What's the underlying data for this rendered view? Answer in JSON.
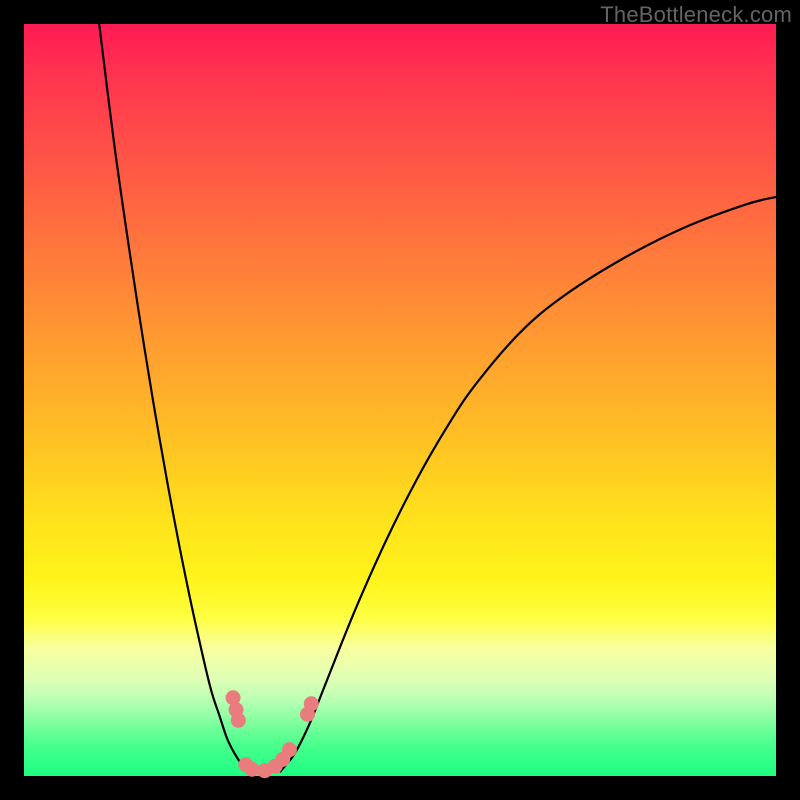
{
  "watermark": "TheBottleneck.com",
  "colors": {
    "frame": "#000000",
    "gradient_top": "#ff1a53",
    "gradient_bottom": "#1dff82",
    "curve": "#000000",
    "markers": "#e97c7c"
  },
  "chart_data": {
    "type": "line",
    "title": "",
    "xlabel": "",
    "ylabel": "",
    "xlim": [
      0,
      100
    ],
    "ylim": [
      0,
      100
    ],
    "grid": false,
    "legend": false,
    "series": [
      {
        "name": "left-branch",
        "x": [
          10,
          12,
          14,
          16,
          18,
          20,
          22,
          24,
          25,
          26,
          27,
          28,
          29,
          30
        ],
        "y": [
          100,
          84,
          70,
          57,
          45,
          34,
          24,
          15,
          11,
          8,
          5,
          3,
          1.5,
          0.5
        ]
      },
      {
        "name": "right-branch",
        "x": [
          34,
          36,
          38,
          40,
          44,
          48,
          52,
          56,
          60,
          66,
          72,
          80,
          88,
          96,
          100
        ],
        "y": [
          0.5,
          3,
          7,
          12,
          22,
          31,
          39,
          46,
          52,
          59,
          64,
          69,
          73,
          76,
          77
        ]
      }
    ],
    "markers": [
      {
        "name": "left-vertical-top",
        "x": 27.8,
        "y": 10.4
      },
      {
        "name": "left-vertical-mid",
        "x": 28.2,
        "y": 8.8
      },
      {
        "name": "left-vertical-bottom",
        "x": 28.5,
        "y": 7.4
      },
      {
        "name": "trough-left-a",
        "x": 29.5,
        "y": 1.5
      },
      {
        "name": "trough-left-b",
        "x": 30.3,
        "y": 0.9
      },
      {
        "name": "trough-mid",
        "x": 32.0,
        "y": 0.7
      },
      {
        "name": "trough-right-a",
        "x": 33.4,
        "y": 1.3
      },
      {
        "name": "trough-right-b",
        "x": 34.4,
        "y": 2.2
      },
      {
        "name": "right-low",
        "x": 35.3,
        "y": 3.5
      },
      {
        "name": "right-detached-lower",
        "x": 37.7,
        "y": 8.2
      },
      {
        "name": "right-detached-upper",
        "x": 38.2,
        "y": 9.6
      }
    ]
  }
}
